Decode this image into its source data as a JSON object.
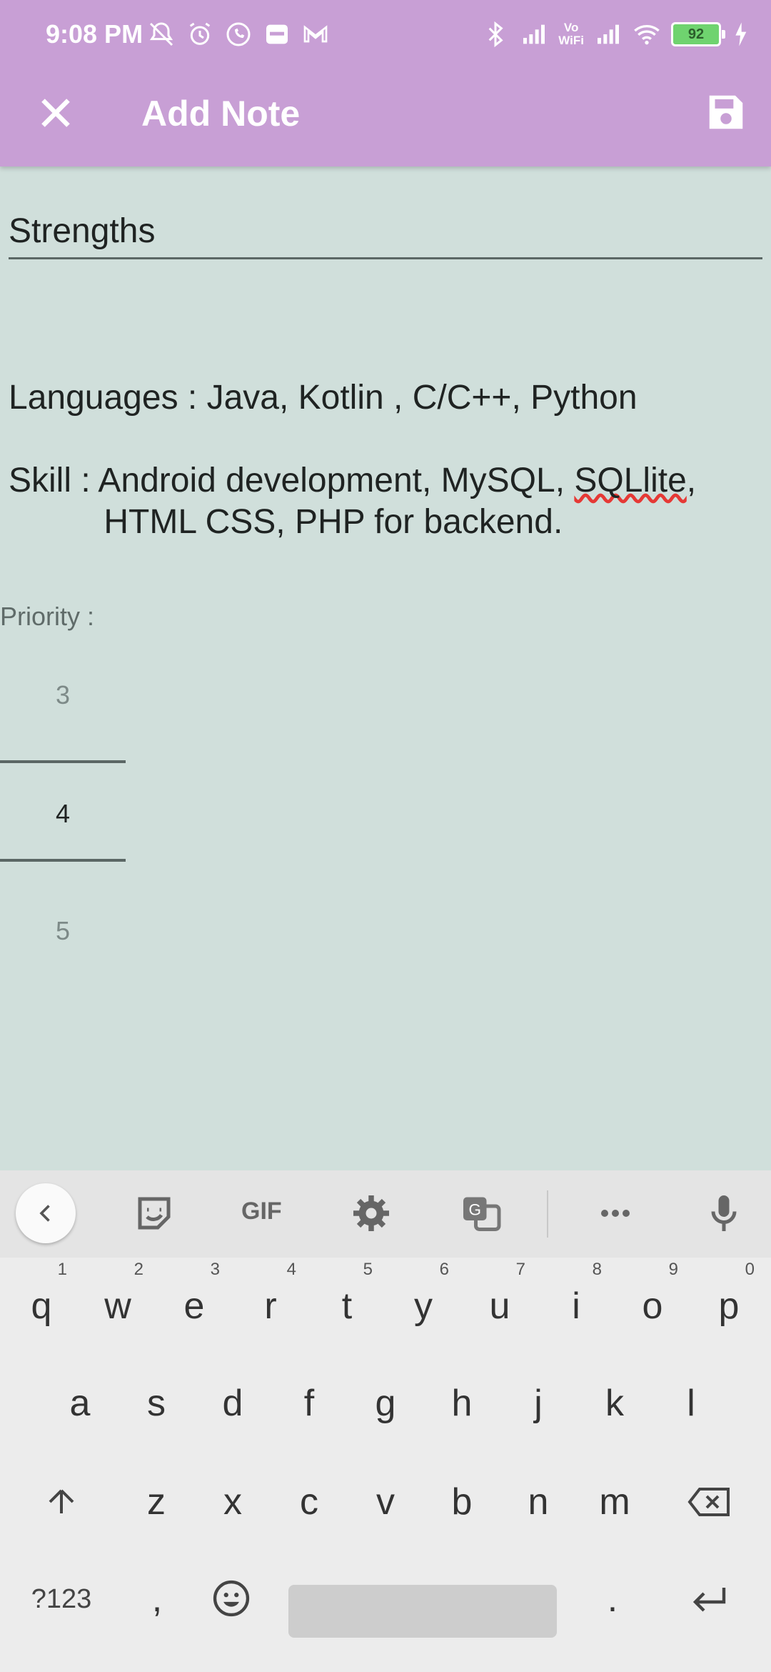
{
  "status_bar": {
    "time": "9:08 PM",
    "battery": "92",
    "vowifi_top": "Vo",
    "vowifi_bottom": "WiFi"
  },
  "toolbar": {
    "title": "Add Note",
    "close_icon": "close-icon",
    "save_icon": "save-icon"
  },
  "note": {
    "title": "Strengths",
    "body_line1": "Languages : Java, Kotlin , C/C++, Python",
    "body_line2_prefix": "Skill : Android development, MySQL, ",
    "body_line2_misspelled": "SQLlite",
    "body_line2_suffix": ",",
    "body_line3": "          HTML CSS, PHP for backend."
  },
  "priority": {
    "label": "Priority :",
    "options": [
      "3",
      "4",
      "5"
    ],
    "selected": "4"
  },
  "keyboard": {
    "toolbar_gif": "GIF",
    "row1": [
      {
        "key": "q",
        "num": "1"
      },
      {
        "key": "w",
        "num": "2"
      },
      {
        "key": "e",
        "num": "3"
      },
      {
        "key": "r",
        "num": "4"
      },
      {
        "key": "t",
        "num": "5"
      },
      {
        "key": "y",
        "num": "6"
      },
      {
        "key": "u",
        "num": "7"
      },
      {
        "key": "i",
        "num": "8"
      },
      {
        "key": "o",
        "num": "9"
      },
      {
        "key": "p",
        "num": "0"
      }
    ],
    "row2": [
      "a",
      "s",
      "d",
      "f",
      "g",
      "h",
      "j",
      "k",
      "l"
    ],
    "row3": [
      "z",
      "x",
      "c",
      "v",
      "b",
      "n",
      "m"
    ],
    "symbols_key": "?123",
    "comma_key": ",",
    "period_key": "."
  },
  "colors": {
    "appbar": "#c89fd5",
    "background": "#d0dfdb",
    "spell_underline": "#e53935"
  }
}
